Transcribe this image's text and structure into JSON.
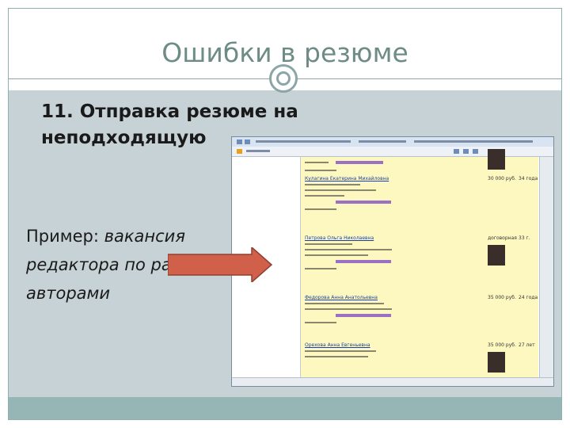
{
  "slide": {
    "title": "Ошибки в резюме",
    "heading": "11. Отправка резюме на неподходящую",
    "example_label": "Пример:",
    "example_text": " вакансия редактора по работе с авторами"
  },
  "screenshot": {
    "records": [
      {
        "name": "",
        "salary": "",
        "age": ""
      },
      {
        "name": "Кулагина Екатерина Михайловна",
        "salary": "30 000 руб.",
        "age": "34 года"
      },
      {
        "name": "Петрова Ольга Николаевна",
        "salary": "договорная",
        "age": "33 г."
      },
      {
        "name": "Федорова Анна Анатольевна",
        "salary": "35 000 руб.",
        "age": "24 года"
      },
      {
        "name": "Орехова Анна Евгеньевна",
        "salary": "35 000 руб.",
        "age": "27 лет"
      }
    ]
  },
  "colors": {
    "title": "#6e8c86",
    "content_bg": "#c7d2d6",
    "footer_band": "#96b5b5",
    "arrow_fill": "#d0604a",
    "page_bg": "#fdf8c0"
  }
}
